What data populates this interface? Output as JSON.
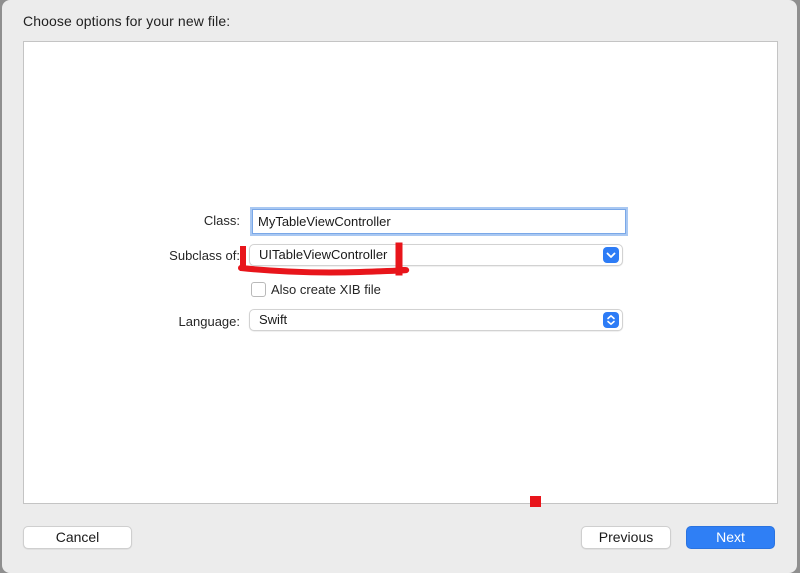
{
  "dialog": {
    "title": "Choose options for your new file:"
  },
  "form": {
    "class_label": "Class:",
    "class_value": "MyTableViewController",
    "subclass_label": "Subclass of:",
    "subclass_value": "UITableViewController",
    "xib_label": "Also create XIB file",
    "xib_checked": false,
    "language_label": "Language:",
    "language_value": "Swift"
  },
  "buttons": {
    "cancel": "Cancel",
    "previous": "Previous",
    "next": "Next"
  },
  "colors": {
    "accent": "#2f7ff5",
    "annotation": "#e8151b"
  },
  "icons": {
    "popup_arrow": "up-down-chevron-icon",
    "popup_arrow_single": "chevron-down-icon"
  }
}
